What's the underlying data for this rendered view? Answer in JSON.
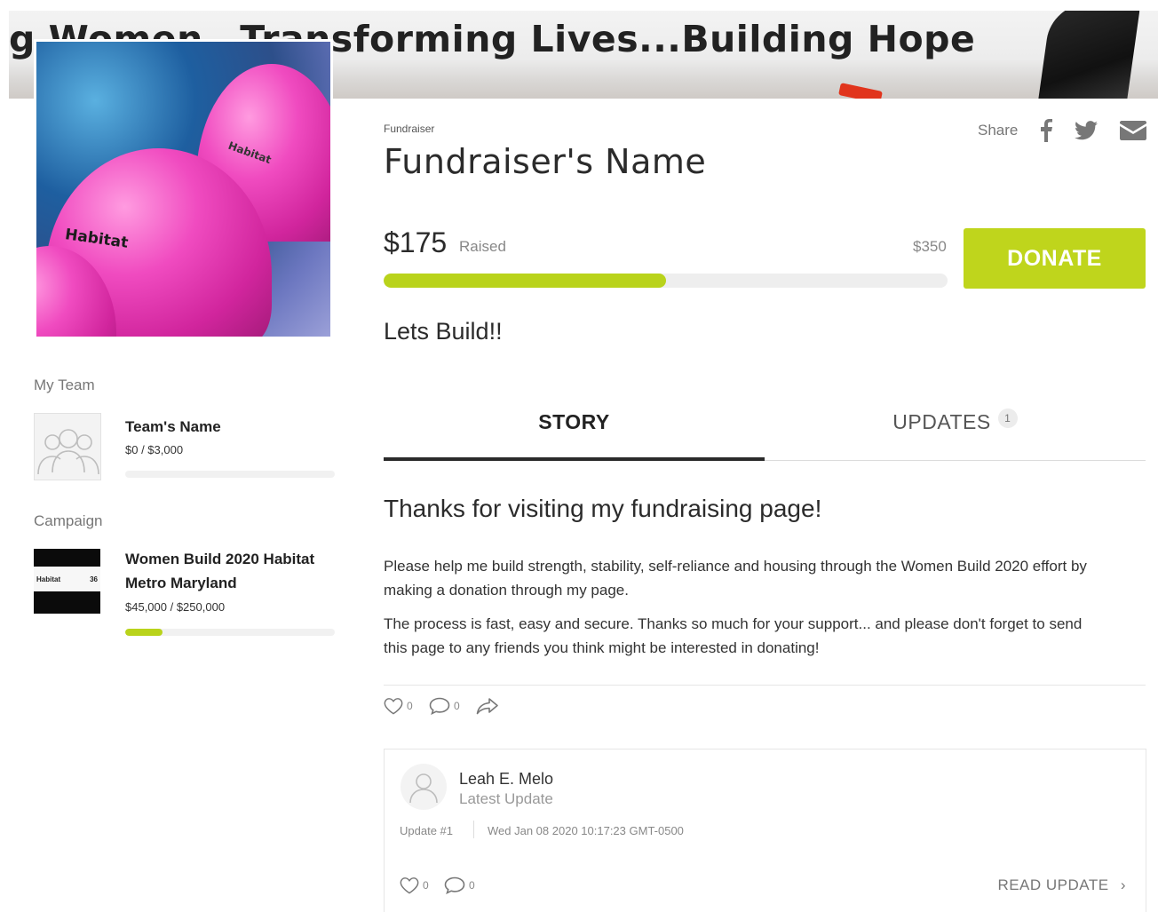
{
  "banner": {
    "text": "g Women…Transforming Lives...Building Hope"
  },
  "photo": {
    "logo_text": "Habitat",
    "logo_text_small": "Habitat"
  },
  "sidebar": {
    "team_heading": "My Team",
    "team": {
      "name": "Team's Name",
      "amount": "$0 / $3,000",
      "progress": 0.0
    },
    "campaign_heading": "Campaign",
    "campaign": {
      "name_line1": "Women Build 2020 Habitat",
      "name_line2": "Metro Maryland",
      "amount": "$45,000 / $250,000",
      "progress": 0.18,
      "thumb_left": "Habitat",
      "thumb_right": "36"
    }
  },
  "header": {
    "eyebrow": "Fundraiser",
    "name": "Fundraiser's Name",
    "share_label": "Share",
    "share_icons": [
      "facebook-icon",
      "twitter-icon",
      "email-icon"
    ]
  },
  "progress": {
    "raised": "$175",
    "raised_label": "Raised",
    "goal": "$350",
    "fraction": 0.5,
    "donate_label": "DONATE"
  },
  "headline": "Lets Build!!",
  "tabs": [
    {
      "label": "STORY",
      "active": true
    },
    {
      "label": "UPDATES",
      "badge": "1",
      "active": false
    }
  ],
  "story": {
    "title": "Thanks for visiting my fundraising page!",
    "p1_line1": "Please help me build strength, stability, self-reliance and housing through the Women Build 2020 effort by",
    "p1_line2": "making a donation through my page.",
    "p2_line1": "The process is fast, easy and secure. Thanks so much for your support... and please don't forget to send",
    "p2_line2": "this page to any friends you think might be interested in donating!",
    "likes": "0",
    "comments": "0"
  },
  "update": {
    "author": "Leah E. Melo",
    "subtitle": "Latest Update",
    "number": "Update #1",
    "date": "Wed Jan 08 2020 10:17:23 GMT-0500",
    "likes": "0",
    "comments": "0",
    "read_label": "READ UPDATE"
  },
  "colors": {
    "accent": "#bfd51c",
    "progress": "#b9d31b",
    "text": "#2b2b2b",
    "muted": "#888888"
  }
}
